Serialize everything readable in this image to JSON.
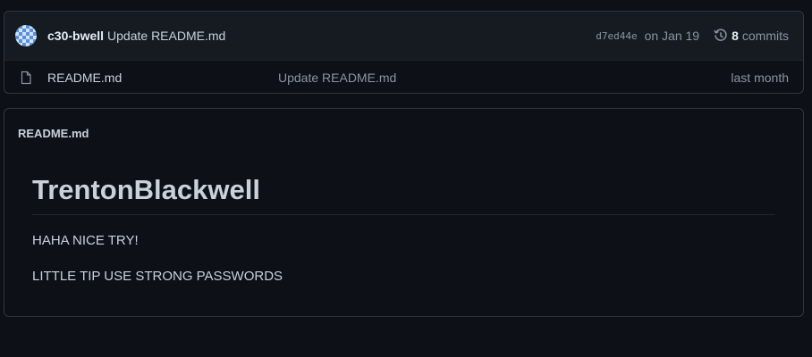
{
  "latest_commit": {
    "author": "c30-bwell",
    "message": "Update README.md",
    "sha": "d7ed44e",
    "date": "on Jan 19",
    "commits_count": "8",
    "commits_label": "commits"
  },
  "files": [
    {
      "name": "README.md",
      "commit_message": "Update README.md",
      "age": "last month",
      "icon": "file-icon"
    }
  ],
  "readme": {
    "filename": "README.md",
    "heading": "TrentonBlackwell",
    "paragraphs": [
      "HAHA NICE TRY!",
      "LITTLE TIP USE STRONG PASSWORDS"
    ]
  },
  "colors": {
    "background": "#0d1117",
    "header_background": "#161b22",
    "border": "#30363d",
    "text": "#c9d1d9",
    "muted": "#8b949e"
  }
}
